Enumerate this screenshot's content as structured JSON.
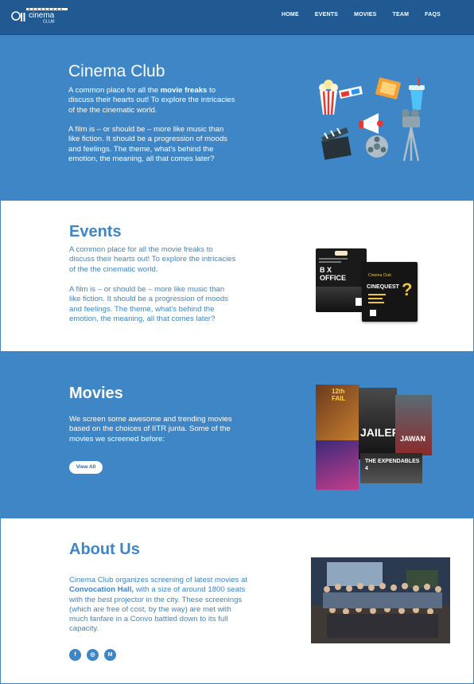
{
  "nav": {
    "logo_text": "cinema club",
    "links": [
      "HOME",
      "EVENTS",
      "MOVIES",
      "TEAM",
      "FAQS"
    ]
  },
  "hero": {
    "title": "Cinema Club",
    "p1_pre": "A common place for all the ",
    "p1_bold": "movie freaks",
    "p1_post": " to discuss their hearts out! To explore the intricacies of the the cinematic world.",
    "p2": "A film is – or should be – more like music than like fiction. It should be a progression of moods and feelings. The theme, what's behind the emotion, the meaning, all that comes later?"
  },
  "events": {
    "title": "Events",
    "p1": "A common place for all the movie freaks to discuss their hearts out! To explore the intricacies of the the cinematic world.",
    "p2": "A film is – or should be – more like music than like fiction. It should be a progression of moods and feelings. The theme, what's behind the emotion, the meaning, all that comes later?",
    "poster1_title": "B X OFFICE",
    "poster2_brand": "Cinema Club",
    "poster2_title": "CINEQUEST"
  },
  "movies": {
    "title": "Movies",
    "text": "We screen some awesome and trending movies based on the choices of IITR junta. Some of the movies we screened before:",
    "button": "View All",
    "tiles": [
      "12th FAIL",
      "JAILER",
      "JAWAN",
      "THE EXPENDABLES 4"
    ]
  },
  "about": {
    "title": "About Us",
    "t1": "Cinema Club organizes screening of latest movies at ",
    "t_bold": "Convocation Hall,",
    "t2": " with a size of around 1800 seats with the best projector in the city. These screenings (which are free of cost, by the way) are met with much fanfare in a Convo battled down to its full capacity.",
    "socials": [
      "f",
      "◎",
      "M"
    ]
  }
}
